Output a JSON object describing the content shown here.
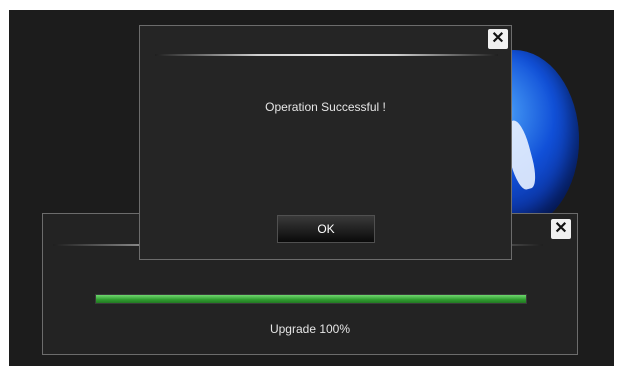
{
  "upgrade_dialog": {
    "progress_fraction": 1.0,
    "progress_label": "Upgrade 100%",
    "close_symbol": "✕",
    "progress_color": "#3cb043"
  },
  "message_dialog": {
    "message": "Operation Successful !",
    "ok_label": "OK",
    "close_symbol": "✕"
  },
  "background": {
    "logo_icon": "blue-globe-logo"
  }
}
